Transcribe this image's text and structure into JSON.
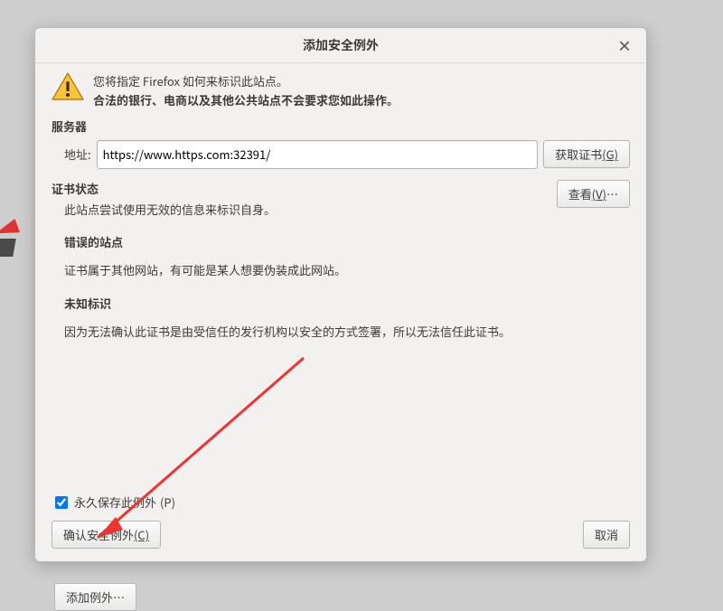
{
  "dialog": {
    "title": "添加安全例外",
    "close_symbol": "×",
    "intro": {
      "line1": "您将指定 Firefox 如何来标识此站点。",
      "line2": "合法的银行、电商以及其他公共站点不会要求您如此操作。"
    },
    "server": {
      "label": "服务器",
      "addr_label": "地址:",
      "addr_value": "https://www.https.com:32391/",
      "get_cert_label": "获取证书",
      "get_cert_key": "(G)"
    },
    "status": {
      "label": "证书状态",
      "desc": "此站点尝试使用无效的信息来标识自身。",
      "view_label": "查看",
      "view_key": "(V)",
      "view_suffix": "…"
    },
    "wrong_site": {
      "heading": "错误的站点",
      "desc": "证书属于其他网站，有可能是某人想要伪装成此网站。"
    },
    "unknown": {
      "heading": "未知标识",
      "desc": "因为无法确认此证书是由受信任的发行机构以安全的方式签署，所以无法信任此证书。"
    },
    "permanent": {
      "label": "永久保存此例外",
      "key": "(P)",
      "checked": true
    },
    "confirm": {
      "label": "确认安全例外",
      "key": "(C)"
    },
    "cancel_label": "取消"
  },
  "below_button_label": "添加例外…"
}
